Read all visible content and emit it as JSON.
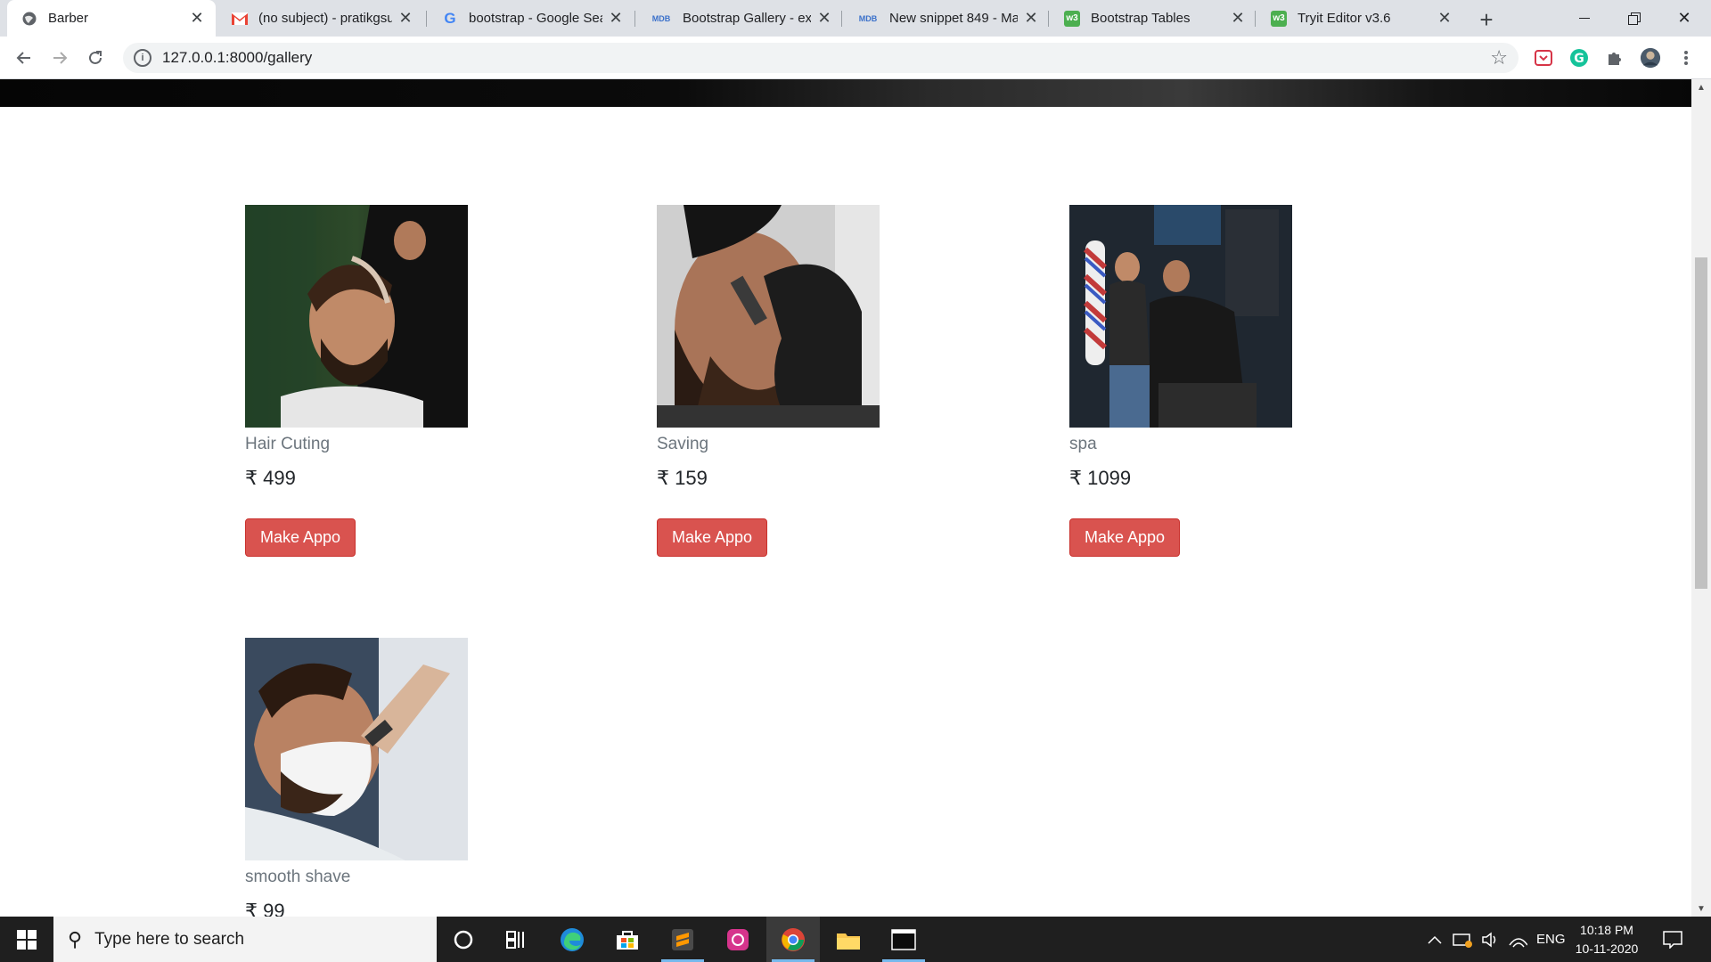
{
  "browser": {
    "tabs": [
      {
        "title": "Barber",
        "icon": "globe-icon",
        "active": true
      },
      {
        "title": "(no subject) - pratikgsu",
        "icon": "gmail-icon"
      },
      {
        "title": "bootstrap - Google Sea",
        "icon": "google-icon"
      },
      {
        "title": "Bootstrap Gallery - exa",
        "icon": "mdb-icon"
      },
      {
        "title": "New snippet 849 - Mat",
        "icon": "mdb-icon"
      },
      {
        "title": "Bootstrap Tables",
        "icon": "w3-icon"
      },
      {
        "title": "Tryit Editor v3.6",
        "icon": "w3-icon"
      }
    ],
    "url": "127.0.0.1:8000/gallery",
    "colors": {
      "tabbar": "#dee1e6",
      "omnibox": "#f1f3f4"
    }
  },
  "gallery": {
    "currency": "₹",
    "button_label": "Make Appo",
    "button_color": "#d9534f",
    "items": [
      {
        "name": "Hair Cuting",
        "price": "499"
      },
      {
        "name": "Saving",
        "price": "159"
      },
      {
        "name": "spa",
        "price": "1099"
      },
      {
        "name": "smooth shave",
        "price": "99"
      }
    ]
  },
  "taskbar": {
    "search_placeholder": "Type here to search",
    "language": "ENG",
    "time": "10:18 PM",
    "date": "10-11-2020",
    "apps": [
      "cortana-icon",
      "task-view-icon",
      "edge-icon",
      "store-icon",
      "sublime-icon",
      "app-icon",
      "chrome-icon",
      "file-explorer-icon",
      "terminal-icon"
    ]
  }
}
